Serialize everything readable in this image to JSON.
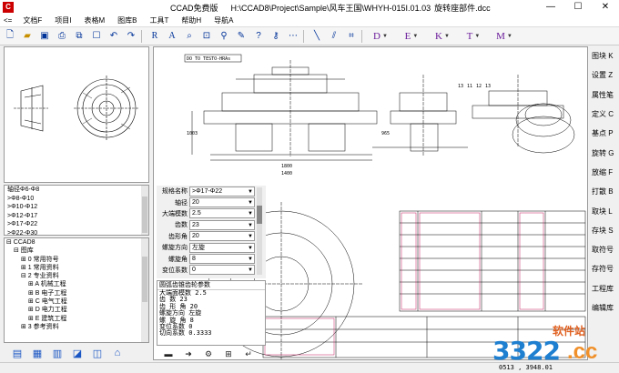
{
  "window": {
    "app_name": "CCAD免费版",
    "path": "H:\\CCAD8\\Project\\Sample\\风车王国\\WHYH-015I.01.03",
    "file": "旋转座部件.dcc",
    "minimize": "—",
    "maximize": "☐",
    "close": "✕"
  },
  "menu": {
    "arrows": "<=",
    "items": [
      "文档F",
      "项目I",
      "表格M",
      "图库B",
      "工具T",
      "帮助H",
      "导航A"
    ]
  },
  "toolbar": {
    "letters": [
      "D",
      "E",
      "K",
      "T",
      "M"
    ]
  },
  "right_panel": [
    "图块 K",
    "设置 Z",
    "属性笔",
    "定义 C",
    "基点 P",
    "旋转 G",
    "放缩 F",
    "打散 B",
    "取块 L",
    "存块 S",
    "取符号",
    "存符号",
    "工程库",
    "编辑库"
  ],
  "spec_list": {
    "items": [
      "轴径Φ6-Φ8",
      ">Φ8-Φ10",
      ">Φ10-Φ12",
      ">Φ12-Φ17",
      ">Φ17-Φ22",
      ">Φ22-Φ30"
    ]
  },
  "tree": {
    "items": [
      {
        "text": "⊟ CCAD8",
        "indent": 0
      },
      {
        "text": "⊟ 图库",
        "indent": 1
      },
      {
        "text": "⊞ 0 常用符号",
        "indent": 2
      },
      {
        "text": "⊞ 1 常用资料",
        "indent": 2
      },
      {
        "text": "⊟ 2 专业资料",
        "indent": 2
      },
      {
        "text": "⊞ A 机械工程",
        "indent": 3
      },
      {
        "text": "⊞ B 电子工程",
        "indent": 3
      },
      {
        "text": "⊞ C 电气工程",
        "indent": 3
      },
      {
        "text": "⊞ D 电力工程",
        "indent": 3
      },
      {
        "text": "⊞ E 建筑工程",
        "indent": 3
      },
      {
        "text": "⊞ 3 参考资料",
        "indent": 2
      }
    ]
  },
  "params": {
    "rows": [
      {
        "label": "规格名称",
        "value": ">Φ17-Φ22"
      },
      {
        "label": "轴径",
        "value": "20"
      },
      {
        "label": "大端模数",
        "value": "2.5"
      },
      {
        "label": "齿数",
        "value": "23"
      },
      {
        "label": "齿形角",
        "value": "20"
      },
      {
        "label": "螺旋方向",
        "value": "左旋"
      },
      {
        "label": "螺旋角",
        "value": "8"
      },
      {
        "label": "变位系数",
        "value": "0"
      }
    ]
  },
  "info": {
    "title": "圆弧齿锥齿轮参数",
    "lines": [
      "大端面模数 2.5",
      "齿  数 23",
      "齿 形 角 20",
      "螺旋方向 左旋",
      "螺 旋 角 8",
      "变位系数 0",
      "切向系数 0.3333"
    ]
  },
  "drawing": {
    "header_label": "DO TO TESTO-HRAs",
    "dims": [
      "1800",
      "1003",
      "1400",
      "965",
      "13",
      "11",
      "12",
      "13"
    ]
  },
  "status": {
    "coords": "0513  ,  3948.01"
  },
  "watermark": {
    "site": "软件站",
    "number": "3322",
    "tld": ".cc"
  }
}
